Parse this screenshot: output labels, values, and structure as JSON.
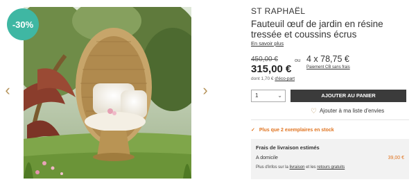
{
  "gallery": {
    "discount_badge": "-30%",
    "prev_arrow": "‹",
    "next_arrow": "›"
  },
  "product": {
    "brand": "ST RAPHAËL",
    "title": "Fauteuil œuf de jardin en résine tressée et coussins écrus",
    "learn_more": "En savoir plus",
    "old_price": "450,00 €",
    "price": "315,00 €",
    "eco_prefix": "dont 1,70 € ",
    "eco_link": "d'éco-part",
    "or_label": "ou",
    "installments": "4 x 78,75 €",
    "installments_note": "Paiement CB sans frais"
  },
  "purchase": {
    "quantity": "1",
    "add_to_cart": "AJOUTER AU PANIER",
    "wishlist": "Ajouter à ma liste d'envies"
  },
  "stock": {
    "message": "Plus que 2 exemplaires en stock"
  },
  "shipping": {
    "title": "Frais de livraison estimés",
    "home_label": "A domicile",
    "home_amount": "39,00 €",
    "note_prefix": "Plus d'infos sur la ",
    "note_link1": "livraison",
    "note_middle": " et les ",
    "note_link2": "retours gratuits"
  },
  "colors": {
    "badge": "#3fb7a3",
    "accent": "#b5935a",
    "stock": "#e0731f",
    "button": "#3b3b3b"
  },
  "icons": {
    "prev": "chevron-left-icon",
    "next": "chevron-right-icon",
    "heart": "heart-outline-icon",
    "check": "check-icon",
    "dropdown": "chevron-down-icon"
  }
}
